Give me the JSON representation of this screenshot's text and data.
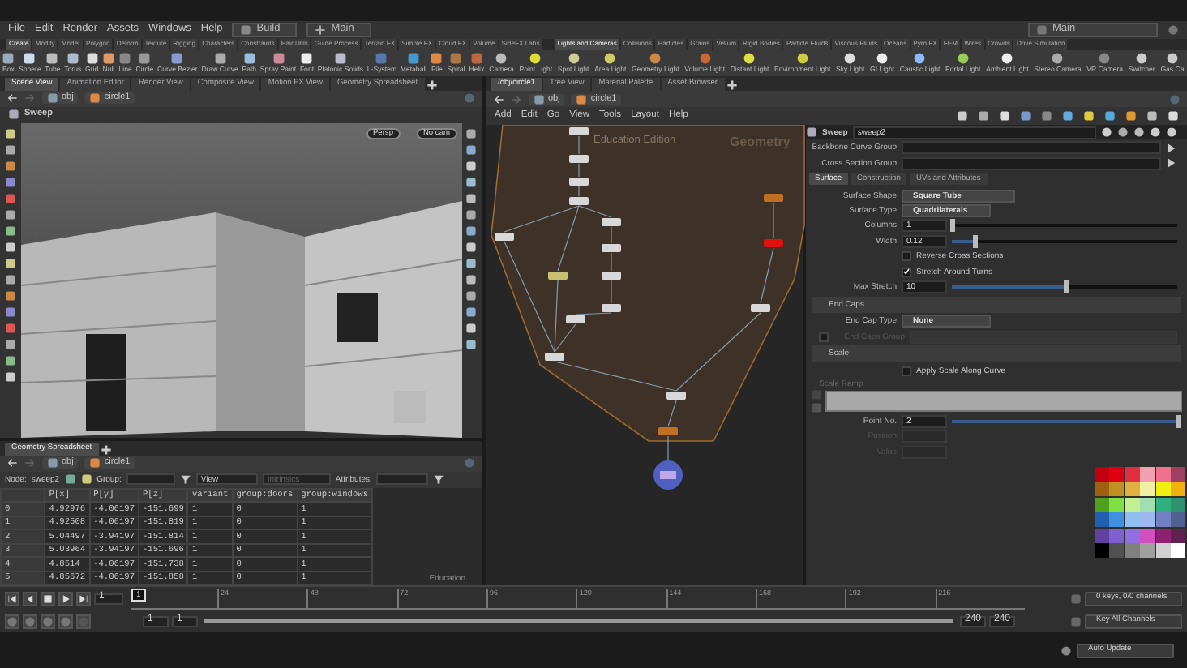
{
  "menu": {
    "items": [
      "File",
      "Edit",
      "Render",
      "Assets",
      "Windows",
      "Help"
    ],
    "desktop": "Build",
    "context": "Main",
    "right_context": "Main"
  },
  "shelf_left": {
    "tabs": [
      {
        "label": "Create",
        "selected": true
      },
      {
        "label": "Modify",
        "selected": false
      },
      {
        "label": "Model",
        "selected": false
      },
      {
        "label": "Polygon",
        "selected": false
      },
      {
        "label": "Deform",
        "selected": false
      },
      {
        "label": "Texture",
        "selected": false
      },
      {
        "label": "Rigging",
        "selected": false
      },
      {
        "label": "Characters",
        "selected": false
      },
      {
        "label": "Constraints",
        "selected": false
      },
      {
        "label": "Hair Utils",
        "selected": false
      },
      {
        "label": "Guide Process",
        "selected": false
      },
      {
        "label": "Terrain FX",
        "selected": false
      },
      {
        "label": "Simple FX",
        "selected": false
      },
      {
        "label": "Cloud FX",
        "selected": false
      },
      {
        "label": "Volume",
        "selected": false
      },
      {
        "label": "SideFX Labs",
        "selected": false
      }
    ],
    "tools": [
      "Box",
      "Sphere",
      "Tube",
      "Torus",
      "Grid",
      "Null",
      "Line",
      "Circle",
      "Curve Bezier",
      "Draw Curve",
      "Path",
      "Spray Paint",
      "Font",
      "Platonic Solids",
      "L-System",
      "Metaball",
      "File",
      "Spiral",
      "Helix"
    ]
  },
  "shelf_right": {
    "tabs": [
      {
        "label": "Lights and Cameras",
        "selected": true
      },
      {
        "label": "Collisions",
        "selected": false
      },
      {
        "label": "Particles",
        "selected": false
      },
      {
        "label": "Grains",
        "selected": false
      },
      {
        "label": "Vellum",
        "selected": false
      },
      {
        "label": "Rigid Bodies",
        "selected": false
      },
      {
        "label": "Particle Fluids",
        "selected": false
      },
      {
        "label": "Viscous Fluids",
        "selected": false
      },
      {
        "label": "Oceans",
        "selected": false
      },
      {
        "label": "Pyro FX",
        "selected": false
      },
      {
        "label": "FEM",
        "selected": false
      },
      {
        "label": "Wires",
        "selected": false
      },
      {
        "label": "Crowds",
        "selected": false
      },
      {
        "label": "Drive Simulation",
        "selected": false
      }
    ],
    "tools": [
      "Camera",
      "Point Light",
      "Spot Light",
      "Area Light",
      "Geometry Light",
      "Volume Light",
      "Distant Light",
      "Environment Light",
      "Sky Light",
      "GI Light",
      "Caustic Light",
      "Portal Light",
      "Ambient Light",
      "Stereo Camera",
      "VR Camera",
      "Switcher",
      "Gas Ca"
    ]
  },
  "scene_pane": {
    "tabs": [
      {
        "label": "Scene View",
        "selected": true
      },
      {
        "label": "Animation Editor",
        "selected": false
      },
      {
        "label": "Render View",
        "selected": false
      },
      {
        "label": "Composite View",
        "selected": false
      },
      {
        "label": "Motion FX View",
        "selected": false
      },
      {
        "label": "Geometry Spreadsheet",
        "selected": false
      }
    ],
    "path": [
      "obj",
      "circle1"
    ],
    "viewport": {
      "title": "Sweep",
      "view": "Persp",
      "camera": "No cam"
    }
  },
  "spreadsheet": {
    "tabs": [
      {
        "label": "Geometry Spreadsheet",
        "selected": true
      }
    ],
    "path": [
      "obj",
      "circle1"
    ],
    "node_label": "Node:",
    "node": "sweep2",
    "group_label": "Group:",
    "view": "View",
    "intrinsics": "Intrinsics",
    "attributes_label": "Attributes:",
    "columns": [
      "",
      "P[x]",
      "P[y]",
      "P[z]",
      "variant",
      "group:doors",
      "group:windows"
    ],
    "rows": [
      [
        "0",
        "4.92976",
        "-4.06197",
        "-151.699",
        "1",
        "0",
        "1"
      ],
      [
        "1",
        "4.92508",
        "-4.06197",
        "-151.819",
        "1",
        "0",
        "1"
      ],
      [
        "2",
        "5.04497",
        "-3.94197",
        "-151.814",
        "1",
        "0",
        "1"
      ],
      [
        "3",
        "5.03964",
        "-3.94197",
        "-151.696",
        "1",
        "0",
        "1"
      ],
      [
        "4",
        "4.8514",
        "-4.06197",
        "-151.738",
        "1",
        "0",
        "1"
      ],
      [
        "5",
        "4.85672",
        "-4.06197",
        "-151.858",
        "1",
        "0",
        "1"
      ]
    ],
    "note": "Education"
  },
  "network": {
    "tabs": [
      {
        "label": "/obj/circle1",
        "selected": true
      },
      {
        "label": "Tree View",
        "selected": false
      },
      {
        "label": "Material Palette",
        "selected": false
      },
      {
        "label": "Asset Browser",
        "selected": false
      }
    ],
    "path": [
      "obj",
      "circle1"
    ],
    "menu": [
      "Add",
      "Edit",
      "Go",
      "View",
      "Tools",
      "Layout",
      "Help"
    ],
    "edition": "Education Edition",
    "box_title": "Geometry"
  },
  "parameters": {
    "node_type": "Sweep",
    "node_name": "sweep2",
    "groups": [
      "Backbone Curve Group",
      "Cross Section Group"
    ],
    "tabs": [
      {
        "label": "Surface",
        "selected": true
      },
      {
        "label": "Construction",
        "selected": false
      },
      {
        "label": "UVs and Attributes",
        "selected": false
      }
    ],
    "rows": [
      {
        "kind": "menu",
        "label": "Surface Shape",
        "value": "Square Tube"
      },
      {
        "kind": "menu",
        "label": "Surface Type",
        "value": "Quadrilaterals"
      },
      {
        "kind": "slider",
        "label": "Columns",
        "value": "1",
        "level": 0.0
      },
      {
        "kind": "slider",
        "label": "Width",
        "value": "0.12",
        "level": 0.1
      },
      {
        "kind": "check",
        "label": "Reverse Cross Sections",
        "checked": false
      },
      {
        "kind": "check",
        "label": "Stretch Around Turns",
        "checked": true
      },
      {
        "kind": "slider",
        "label": "Max Stretch",
        "value": "10",
        "level": 0.5
      },
      {
        "kind": "section",
        "label": "End Caps"
      },
      {
        "kind": "menu",
        "label": "End Cap Type",
        "value": "None"
      },
      {
        "kind": "togglefield",
        "label": "End Caps Group",
        "checked": false,
        "disabled": true
      },
      {
        "kind": "section",
        "label": "Scale"
      },
      {
        "kind": "check",
        "label": "Apply Scale Along Curve",
        "checked": false
      },
      {
        "kind": "ramp",
        "label": "Scale Ramp"
      },
      {
        "kind": "slider",
        "label": "Point No.",
        "value": "2",
        "level": 1.0
      },
      {
        "kind": "field",
        "label": "Position",
        "disabled": true
      },
      {
        "kind": "field",
        "label": "Value",
        "disabled": true
      }
    ]
  },
  "palette": [
    {
      "color": "#c00010"
    },
    {
      "color": "#e00010"
    },
    {
      "color": "#e03040"
    },
    {
      "color": "#f0a0b0"
    },
    {
      "color": "#f07090"
    },
    {
      "color": "#a04060"
    },
    {
      "color": "#a06010"
    },
    {
      "color": "#c09020"
    },
    {
      "color": "#e0b040"
    },
    {
      "color": "#f0f0a0"
    },
    {
      "color": "#f0f010"
    },
    {
      "color": "#f0b010"
    },
    {
      "color": "#50a020"
    },
    {
      "color": "#80e040"
    },
    {
      "color": "#c0f090"
    },
    {
      "color": "#a0e0b0"
    },
    {
      "color": "#30b080"
    },
    {
      "color": "#309070"
    },
    {
      "color": "#2060b0"
    },
    {
      "color": "#4090e0"
    },
    {
      "color": "#90c0f0"
    },
    {
      "color": "#a0b8f0"
    },
    {
      "color": "#7080c0"
    },
    {
      "color": "#506090"
    },
    {
      "color": "#6040a0"
    },
    {
      "color": "#8060d0"
    },
    {
      "color": "#9070e0"
    },
    {
      "color": "#d050c0"
    },
    {
      "color": "#902070"
    },
    {
      "color": "#602050"
    },
    {
      "color": "#000000"
    },
    {
      "color": "#505050"
    },
    {
      "color": "#808080"
    },
    {
      "color": "#a0a0a0"
    },
    {
      "color": "#d0d0d0"
    },
    {
      "color": "#ffffff"
    }
  ],
  "timeline": {
    "frame": "1",
    "frame_marker": "1",
    "range": {
      "level": 1.0
    },
    "ticks": [
      "24",
      "48",
      "72",
      "96",
      "120",
      "144",
      "168",
      "192",
      "216"
    ],
    "start": [
      "1",
      "1"
    ],
    "end": [
      "240",
      "240"
    ],
    "keys": "0 keys, 0/0 channels",
    "key_all": "Key All Channels",
    "auto_update": "Auto Update"
  }
}
